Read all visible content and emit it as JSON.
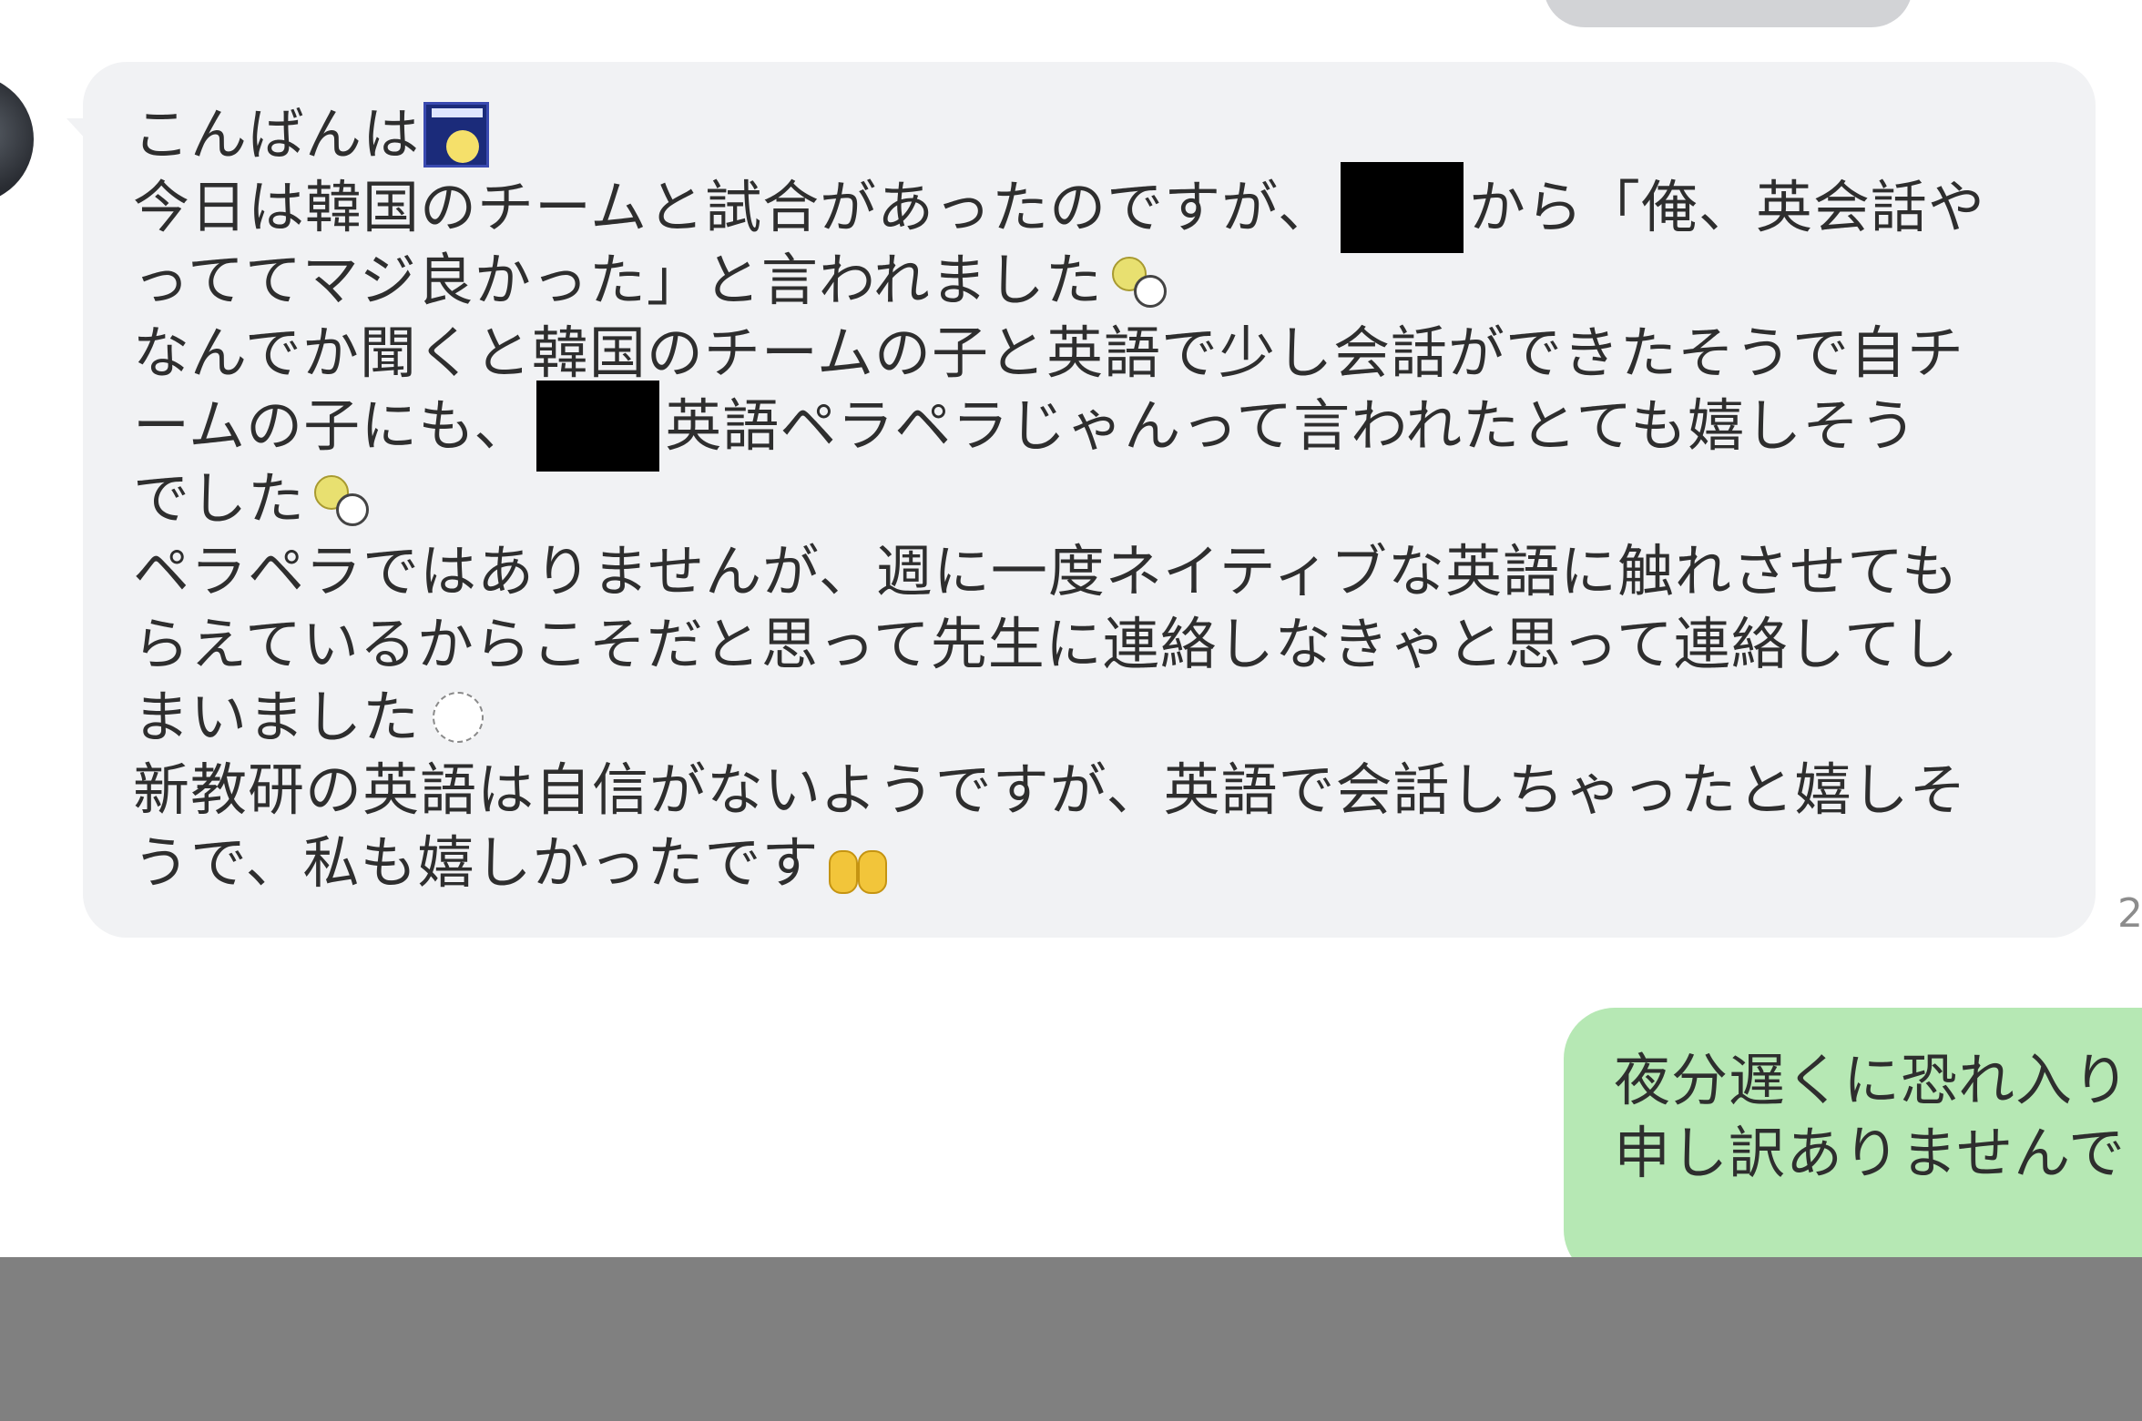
{
  "incoming_message": {
    "lines": [
      [
        "こんばんは"
      ],
      [
        "今日は韓国のチームと試合があったのですが、",
        "から「俺、英会話や"
      ],
      [
        "っててマジ良かった」と言われました"
      ],
      [
        "なんでか聞くと韓国のチームの子と英語で少し会話ができたそうで自チ"
      ],
      [
        "ームの子にも、",
        "英語ペラペラじゃんって言われたとても嬉しそう"
      ],
      [
        "でした"
      ],
      [
        "ペラペラではありませんが、週に一度ネイティブな英語に触れさせても"
      ],
      [
        "らえているからこそだと思って先生に連絡しなきゃと思って連絡してし"
      ],
      [
        "まいました"
      ],
      [
        "新教研の英語は自信がないようですが、英語で会話しちゃったと嬉しそ"
      ],
      [
        "うで、私も嬉しかったです"
      ]
    ],
    "sticker_icons": [
      "sun-sticker-icon",
      "bear-sticker-icon",
      "bear-sticker-icon",
      "sparkle-sticker-icon",
      "raised-hands-emoji-icon"
    ],
    "time_fragment": "2"
  },
  "outgoing_message": {
    "lines": [
      "夜分遅くに恐れ入り",
      "申し訳ありませんで"
    ]
  },
  "colors": {
    "incoming_bubble": "#f1f2f4",
    "outgoing_bubble": "#b6e8b4",
    "bottom_bar": "#808080",
    "redaction": "#000000"
  }
}
